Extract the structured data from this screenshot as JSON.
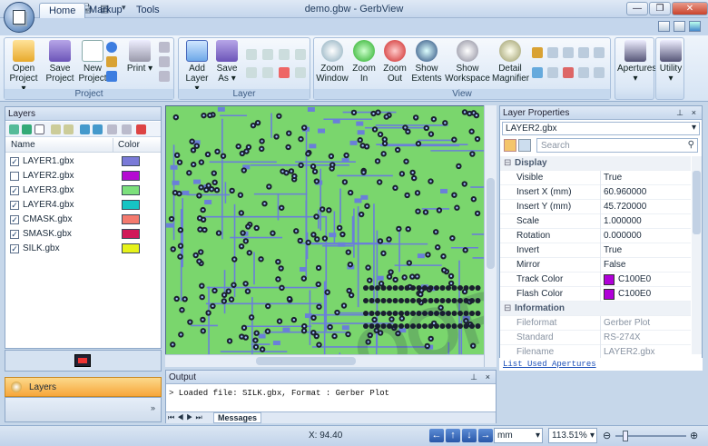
{
  "window": {
    "title": "demo.gbw - GerbView",
    "min": "—",
    "max": "❐",
    "close": "✕"
  },
  "tabs": [
    "Home",
    "Markup",
    "Tools"
  ],
  "ribbon": {
    "project_group": "Project",
    "layer_group": "Layer",
    "view_group": "View",
    "buttons": {
      "open": "Open Project ▾",
      "save_project": "Save Project",
      "new_project": "New Project",
      "print": "Print ▾",
      "add_layer": "Add Layer ▾",
      "save_as": "Save As ▾",
      "zoom_window": "Zoom Window",
      "zoom_in": "Zoom In",
      "zoom_out": "Zoom Out",
      "show_extents": "Show Extents",
      "show_workspace": "Show Workspace",
      "detail_magnifier": "Detail Magnifier",
      "apertures": "Apertures ▾",
      "utility": "Utility ▾"
    }
  },
  "layers_panel": {
    "title": "Layers",
    "col_name": "Name",
    "col_color": "Color",
    "rows": [
      {
        "name": "LAYER1.gbx",
        "checked": true,
        "color": "#7a7ad8"
      },
      {
        "name": "LAYER2.gbx",
        "checked": false,
        "color": "#b40ad2"
      },
      {
        "name": "LAYER3.gbx",
        "checked": true,
        "color": "#7ce07c"
      },
      {
        "name": "LAYER4.gbx",
        "checked": true,
        "color": "#16c4c4"
      },
      {
        "name": "CMASK.gbx",
        "checked": true,
        "color": "#f47a6e"
      },
      {
        "name": "SMASK.gbx",
        "checked": true,
        "color": "#d0185a"
      },
      {
        "name": "SILK.gbx",
        "checked": true,
        "color": "#e6f21a"
      }
    ],
    "nav_button": "Layers"
  },
  "canvas": {
    "watermark": "QQPT.COM",
    "board_color": "#7ad66d",
    "trace_color": "#6a7fd9"
  },
  "output_panel": {
    "title": "Output",
    "line": "> Loaded file: SILK.gbx, Format : Gerber Plot",
    "tab": "Messages"
  },
  "properties": {
    "title": "Layer Properties",
    "selected": "LAYER2.gbx",
    "search_placeholder": "Search",
    "rows": [
      {
        "cat": true,
        "k": "Display"
      },
      {
        "k": "Visible",
        "v": "True"
      },
      {
        "k": "Insert X (mm)",
        "v": "60.960000"
      },
      {
        "k": "Insert Y (mm)",
        "v": "45.720000"
      },
      {
        "k": "Scale",
        "v": "1.000000"
      },
      {
        "k": "Rotation",
        "v": "0.000000"
      },
      {
        "k": "Invert",
        "v": "True"
      },
      {
        "k": "Mirror",
        "v": "False"
      },
      {
        "k": "Track Color",
        "v": "C100E0",
        "swatch": "#b000d8"
      },
      {
        "k": "Flash Color",
        "v": "C100E0",
        "swatch": "#b000d8"
      },
      {
        "cat": true,
        "k": "Information"
      },
      {
        "k": "Fileformat",
        "v": "Gerber Plot",
        "ro": true
      },
      {
        "k": "Standard",
        "v": "RS-274X",
        "ro": true
      },
      {
        "k": "Filename",
        "v": "LAYER2.gbx",
        "ro": true
      }
    ],
    "link": "List Used Apertures"
  },
  "status": {
    "coord": "X: 94.40",
    "unit": "mm",
    "zoom": "113.51%"
  }
}
